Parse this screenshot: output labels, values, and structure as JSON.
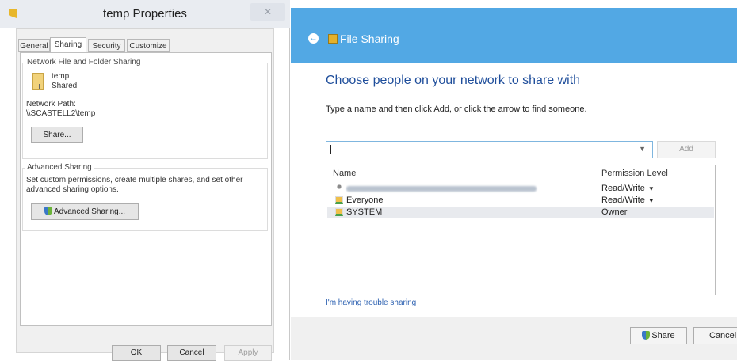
{
  "properties_dialog": {
    "title": "temp Properties",
    "close_glyph": "✕",
    "tabs": [
      {
        "label": "General",
        "active": false
      },
      {
        "label": "Sharing",
        "active": true
      },
      {
        "label": "Security",
        "active": false
      },
      {
        "label": "Customize",
        "active": false
      }
    ],
    "network_sharing": {
      "group_label": "Network File and Folder Sharing",
      "folder_name": "temp",
      "folder_status": "Shared",
      "network_path_label": "Network Path:",
      "network_path": "\\\\SCASTELL2\\temp",
      "share_button": "Share..."
    },
    "advanced_sharing": {
      "group_label": "Advanced Sharing",
      "description": "Set custom permissions, create multiple shares, and set other advanced sharing options.",
      "button": "Advanced Sharing..."
    },
    "footer": {
      "ok": "OK",
      "cancel": "Cancel",
      "apply": "Apply"
    }
  },
  "file_sharing": {
    "title": "File Sharing",
    "back_icon": "back-arrow-icon",
    "heading": "Choose people on your network to share with",
    "instruction": "Type a name and then click Add, or click the arrow to find someone.",
    "input_value": "",
    "add_button": "Add",
    "columns": {
      "name": "Name",
      "permission": "Permission Level"
    },
    "rows": [
      {
        "name": "",
        "permission": "Read/Write",
        "has_dropdown": true,
        "icon": "user-icon",
        "redacted": true
      },
      {
        "name": "Everyone",
        "permission": "Read/Write",
        "has_dropdown": true,
        "icon": "group-icon",
        "redacted": false
      },
      {
        "name": "SYSTEM",
        "permission": "Owner",
        "has_dropdown": false,
        "icon": "group-icon",
        "redacted": false,
        "selected": true
      }
    ],
    "trouble_link": "I'm having trouble sharing",
    "share_button": "Share",
    "cancel_button": "Cancel"
  },
  "colors": {
    "header_blue": "#52a8e4",
    "heading_blue": "#1f4e9b",
    "link_blue": "#2a5fb0"
  }
}
